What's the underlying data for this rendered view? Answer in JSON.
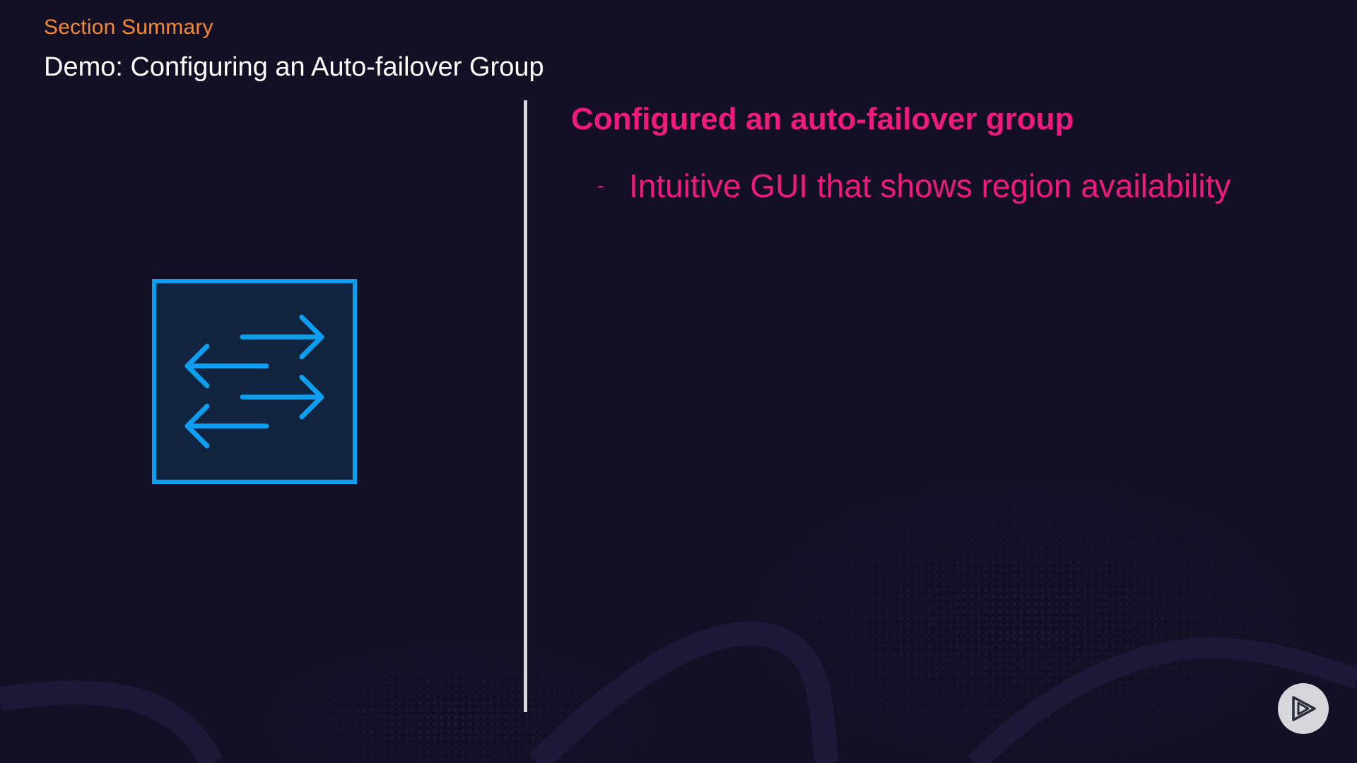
{
  "header": {
    "section_label": "Section Summary",
    "section_title": "Demo: Configuring an Auto-failover Group"
  },
  "content": {
    "heading": "Configured an auto-failover group",
    "bullets": [
      {
        "marker": "-",
        "text": "Intuitive GUI that shows region availability"
      }
    ]
  },
  "icons": {
    "main_icon": "bidirectional-arrows-icon",
    "brand_logo": "play-logo-icon"
  },
  "colors": {
    "background": "#130f24",
    "section_label": "#f7882f",
    "title": "#ffffff",
    "accent": "#f0197d",
    "icon_blue": "#0d9ef0",
    "icon_fill": "#10243f",
    "divider": "#d9d9d9"
  }
}
